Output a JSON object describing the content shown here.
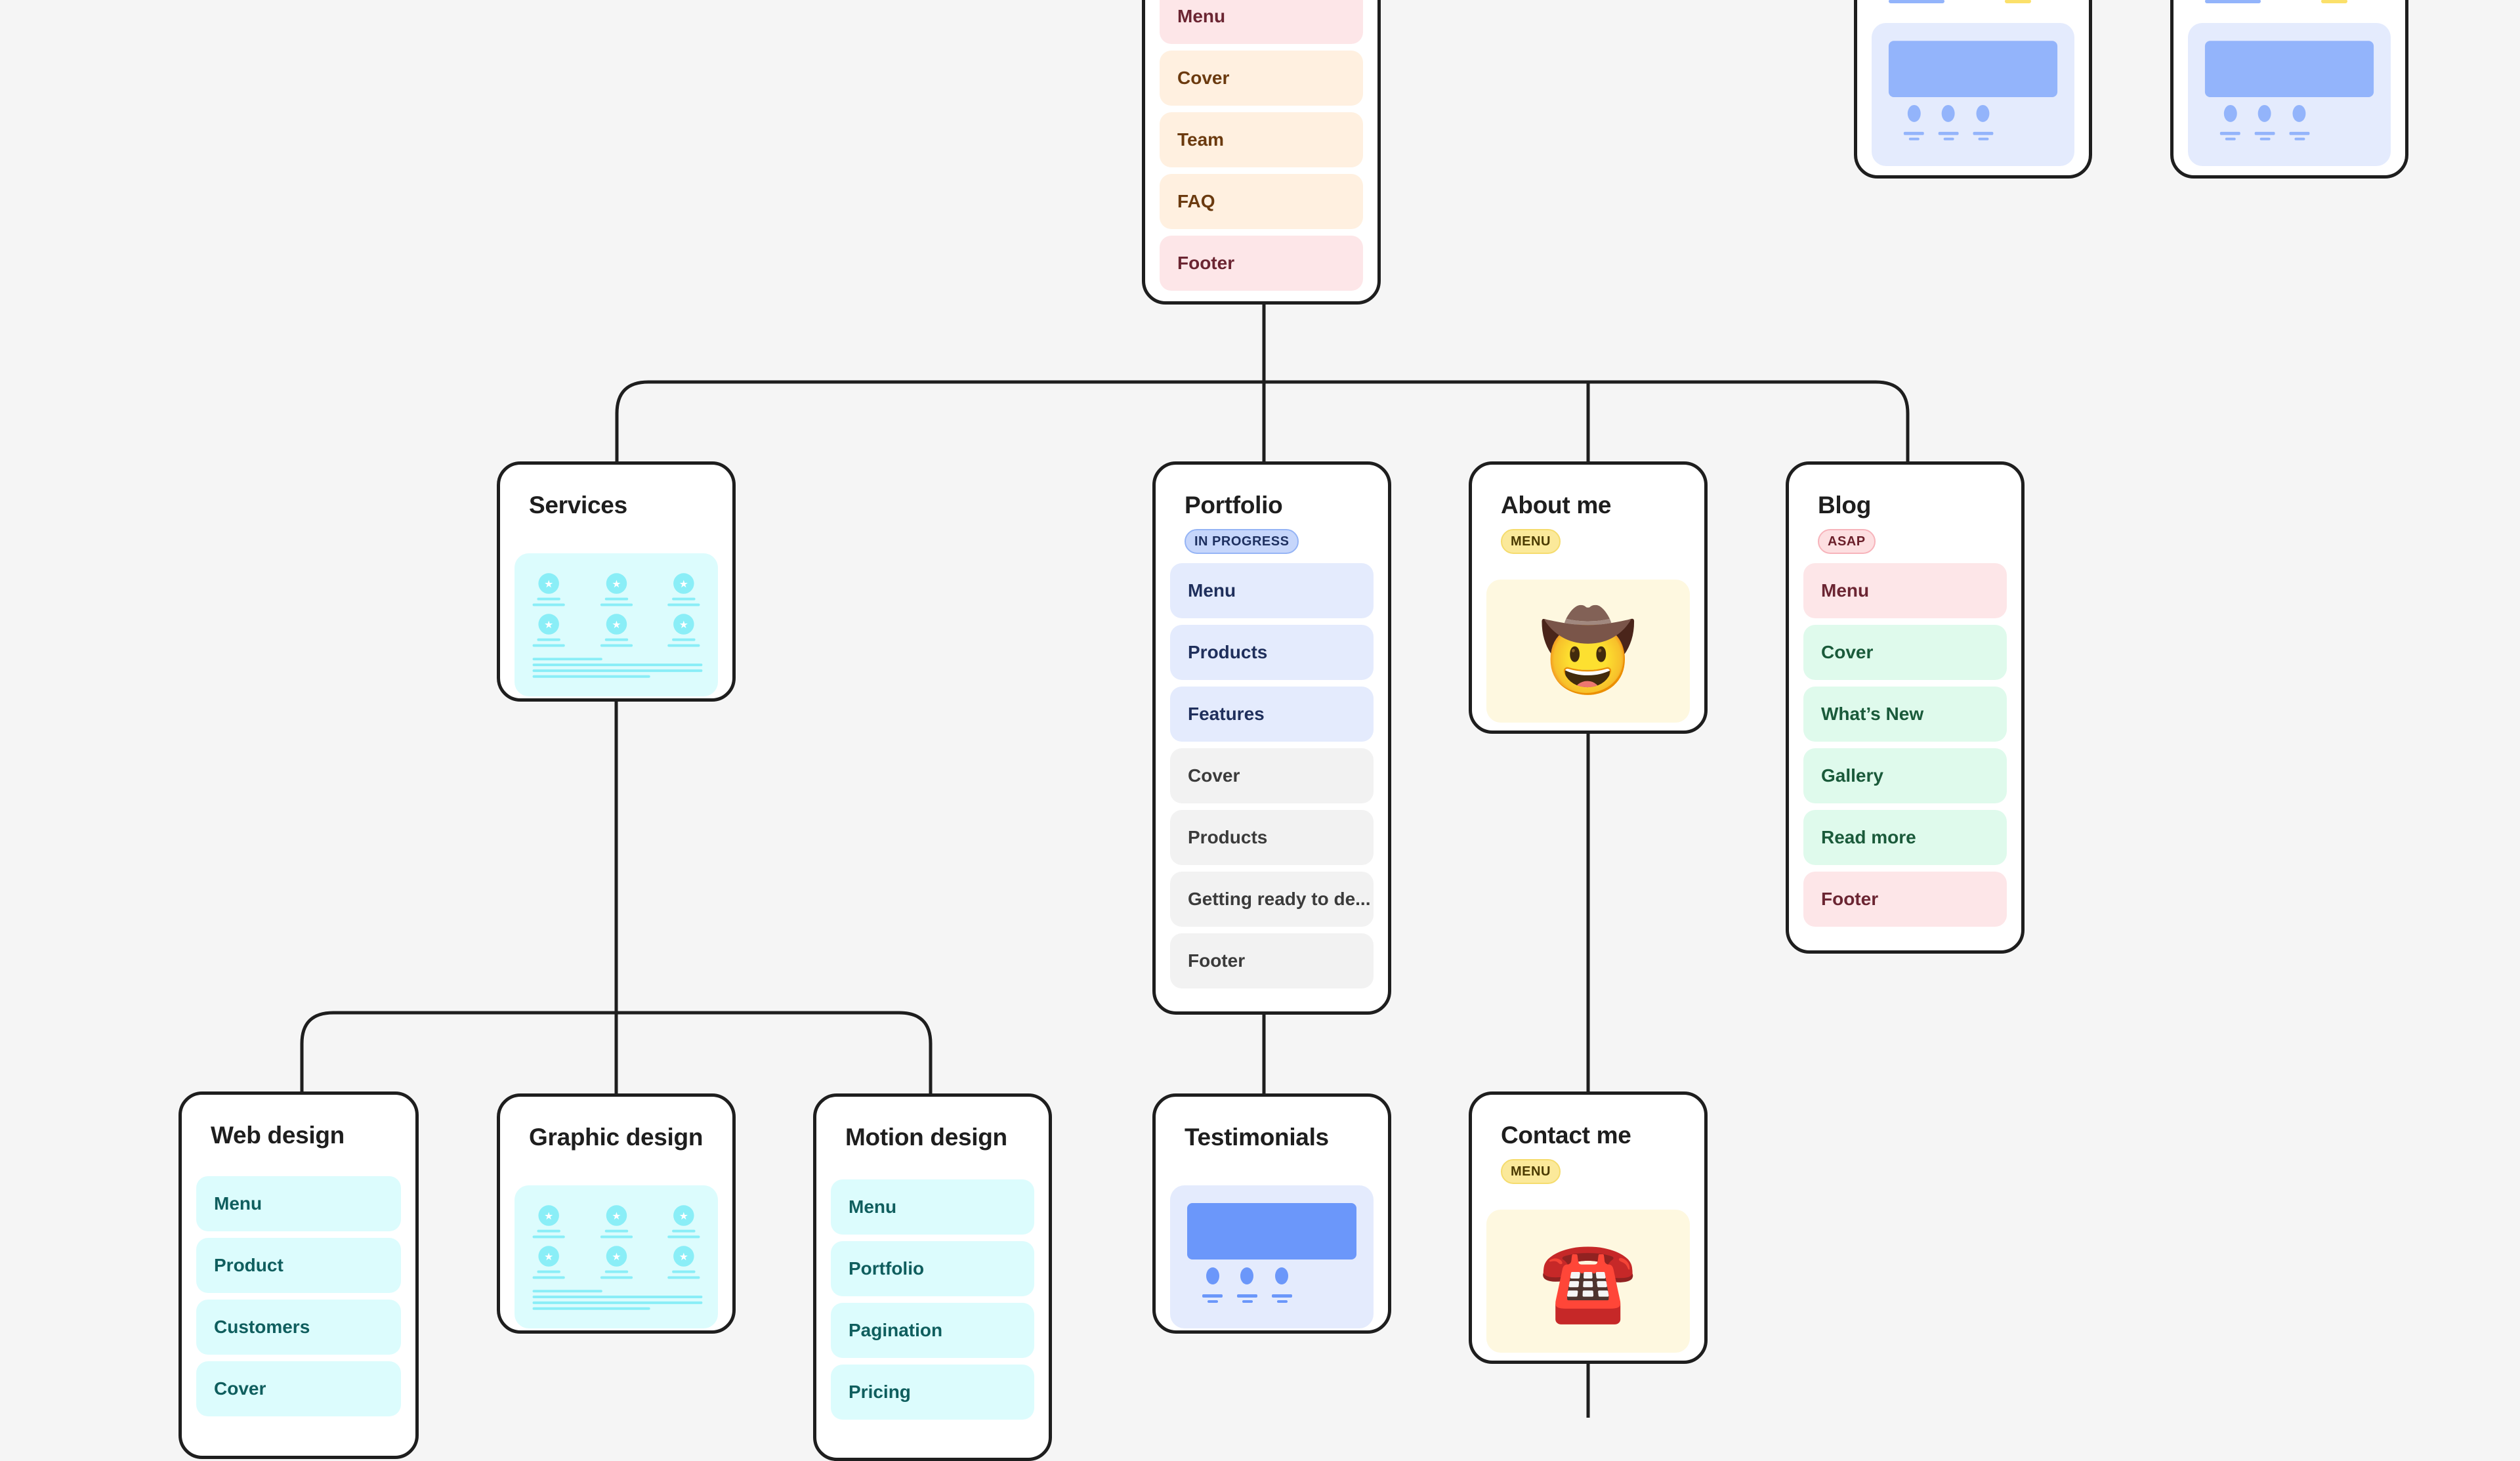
{
  "canvas": {
    "background": "#f5f5f5",
    "stroke_color": "#1e1e1e"
  },
  "top_card": {
    "items": [
      {
        "label": "Menu",
        "color": "pink"
      },
      {
        "label": "Cover",
        "color": "peach"
      },
      {
        "label": "Team",
        "color": "peach"
      },
      {
        "label": "FAQ",
        "color": "peach"
      },
      {
        "label": "Footer",
        "color": "pink"
      }
    ]
  },
  "top_right_cards": [
    {
      "preview": "testimonial-wireframe"
    },
    {
      "preview": "testimonial-wireframe"
    }
  ],
  "services": {
    "title": "Services",
    "preview": "feature-grid-wireframe"
  },
  "portfolio": {
    "title": "Portfolio",
    "badge": "IN PROGRESS",
    "items": [
      {
        "label": "Menu",
        "color": "blue"
      },
      {
        "label": "Products",
        "color": "blue"
      },
      {
        "label": "Features",
        "color": "blue"
      },
      {
        "label": "Cover",
        "color": "gray"
      },
      {
        "label": "Products",
        "color": "gray"
      },
      {
        "label": "Getting ready to de...",
        "color": "gray"
      },
      {
        "label": "Footer",
        "color": "gray"
      }
    ]
  },
  "about_me": {
    "title": "About me",
    "badge": "MENU",
    "emoji": "🤠",
    "emoji_name": "cowboy-face"
  },
  "blog": {
    "title": "Blog",
    "badge": "ASAP",
    "items": [
      {
        "label": "Menu",
        "color": "pink"
      },
      {
        "label": "Cover",
        "color": "green"
      },
      {
        "label": "What’s New",
        "color": "green"
      },
      {
        "label": "Gallery",
        "color": "green"
      },
      {
        "label": "Read more",
        "color": "green"
      },
      {
        "label": "Footer",
        "color": "pink"
      }
    ]
  },
  "web_design": {
    "title": "Web design",
    "items": [
      {
        "label": "Menu",
        "color": "cyan"
      },
      {
        "label": "Product",
        "color": "cyan"
      },
      {
        "label": "Customers",
        "color": "cyan"
      },
      {
        "label": "Cover",
        "color": "cyan"
      }
    ]
  },
  "graphic_design": {
    "title": "Graphic design",
    "preview": "feature-grid-wireframe"
  },
  "motion_design": {
    "title": "Motion design",
    "items": [
      {
        "label": "Menu",
        "color": "cyan"
      },
      {
        "label": "Portfolio",
        "color": "cyan"
      },
      {
        "label": "Pagination",
        "color": "cyan"
      },
      {
        "label": "Pricing",
        "color": "cyan"
      }
    ]
  },
  "testimonials": {
    "title": "Testimonials",
    "preview": "testimonial-wireframe"
  },
  "contact_me": {
    "title": "Contact me",
    "badge": "MENU",
    "emoji": "☎️",
    "emoji_name": "telephone"
  }
}
